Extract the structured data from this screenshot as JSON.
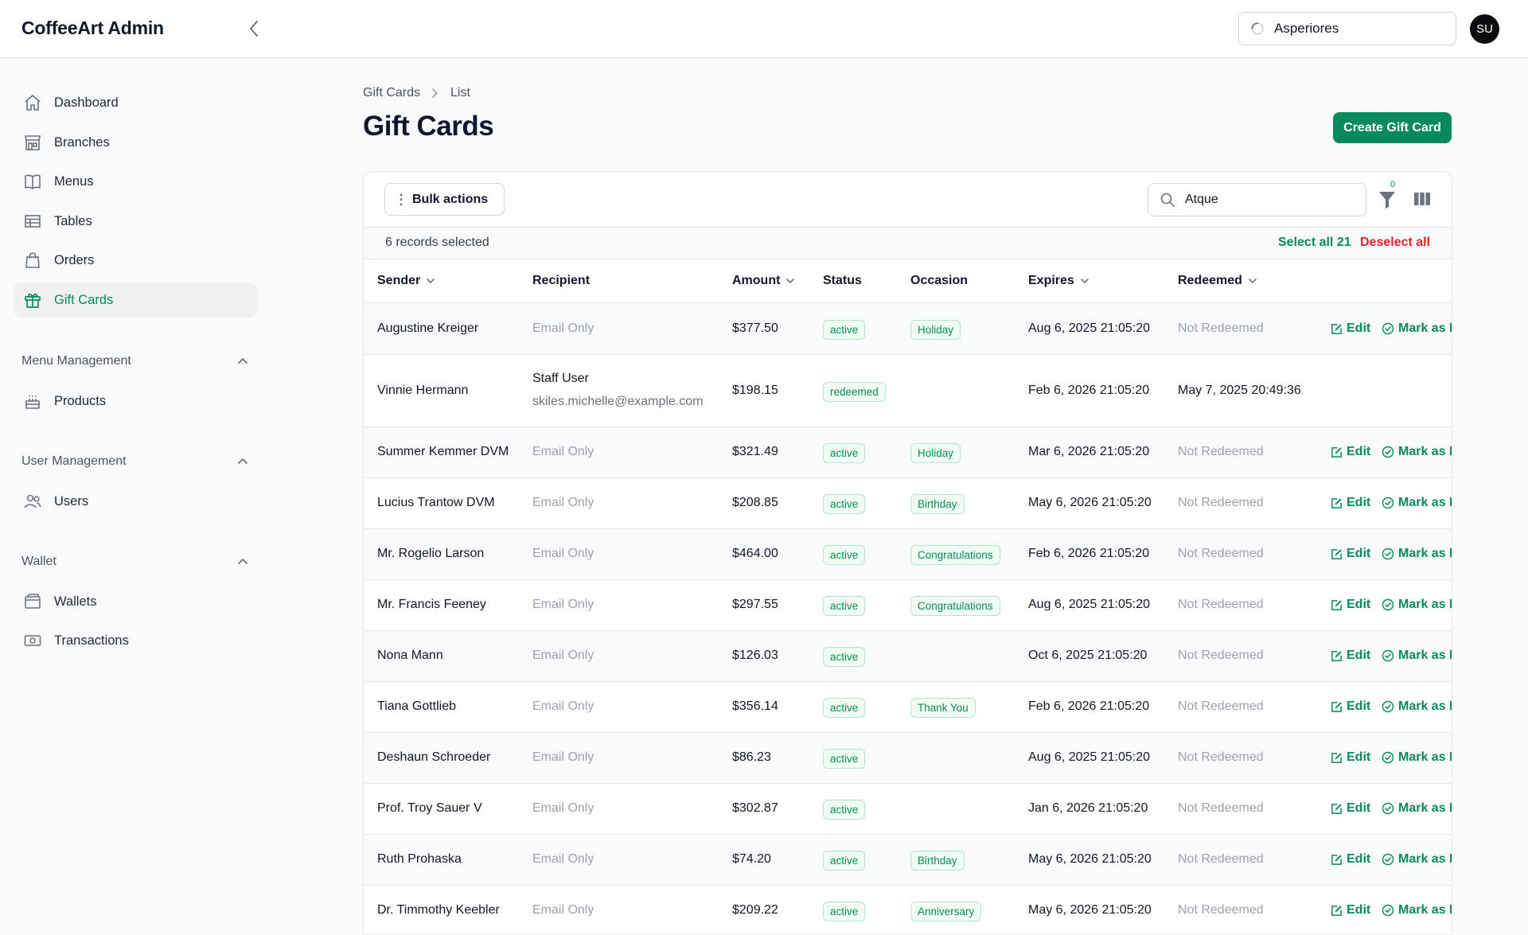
{
  "app": {
    "brand": "CoffeeArt Admin",
    "global_search_value": "Asperiores",
    "avatar_initials": "SU"
  },
  "sidebar": {
    "main_items": [
      {
        "label": "Dashboard",
        "icon": "home-icon"
      },
      {
        "label": "Branches",
        "icon": "store-icon"
      },
      {
        "label": "Menus",
        "icon": "book-icon"
      },
      {
        "label": "Tables",
        "icon": "table-icon"
      },
      {
        "label": "Orders",
        "icon": "bag-icon"
      },
      {
        "label": "Gift Cards",
        "icon": "gift-icon",
        "active": true
      }
    ],
    "groups": [
      {
        "title": "Menu Management",
        "items": [
          {
            "label": "Products",
            "icon": "cake-icon"
          }
        ]
      },
      {
        "title": "User Management",
        "items": [
          {
            "label": "Users",
            "icon": "users-icon"
          }
        ]
      },
      {
        "title": "Wallet",
        "items": [
          {
            "label": "Wallets",
            "icon": "wallet-icon"
          },
          {
            "label": "Transactions",
            "icon": "cash-icon"
          }
        ]
      }
    ]
  },
  "page": {
    "breadcrumb": [
      "Gift Cards",
      "List"
    ],
    "title": "Gift Cards",
    "create_label": "Create Gift Card"
  },
  "table_toolbar": {
    "bulk_label": "Bulk actions",
    "search_value": "Atque",
    "filter_count": "0",
    "selected_text": "6 records selected",
    "select_all_label": "Select all 21",
    "deselect_label": "Deselect all"
  },
  "columns": [
    "Sender",
    "Recipient",
    "Amount",
    "Status",
    "Occasion",
    "Expires",
    "Redeemed"
  ],
  "actions": {
    "edit": "Edit",
    "mark": "Mark as R"
  },
  "rows": [
    {
      "sender": "Augustine Kreiger",
      "recipient": "Email Only",
      "amount": "$377.50",
      "status": "active",
      "occasion": "Holiday",
      "expires": "Aug 6, 2025 21:05:20",
      "redeemed": "Not Redeemed"
    },
    {
      "sender": "Vinnie Hermann",
      "recipient": "Staff User",
      "recipient_email": "skiles.michelle@example.com",
      "amount": "$198.15",
      "status": "redeemed",
      "occasion": "",
      "expires": "Feb 6, 2026 21:05:20",
      "redeemed": "May 7, 2025 20:49:36"
    },
    {
      "sender": "Summer Kemmer DVM",
      "recipient": "Email Only",
      "amount": "$321.49",
      "status": "active",
      "occasion": "Holiday",
      "expires": "Mar 6, 2026 21:05:20",
      "redeemed": "Not Redeemed"
    },
    {
      "sender": "Lucius Trantow DVM",
      "recipient": "Email Only",
      "amount": "$208.85",
      "status": "active",
      "occasion": "Birthday",
      "expires": "May 6, 2026 21:05:20",
      "redeemed": "Not Redeemed"
    },
    {
      "sender": "Mr. Rogelio Larson",
      "recipient": "Email Only",
      "amount": "$464.00",
      "status": "active",
      "occasion": "Congratulations",
      "expires": "Feb 6, 2026 21:05:20",
      "redeemed": "Not Redeemed"
    },
    {
      "sender": "Mr. Francis Feeney",
      "recipient": "Email Only",
      "amount": "$297.55",
      "status": "active",
      "occasion": "Congratulations",
      "expires": "Aug 6, 2025 21:05:20",
      "redeemed": "Not Redeemed"
    },
    {
      "sender": "Nona Mann",
      "recipient": "Email Only",
      "amount": "$126.03",
      "status": "active",
      "occasion": "",
      "expires": "Oct 6, 2025 21:05:20",
      "redeemed": "Not Redeemed"
    },
    {
      "sender": "Tiana Gottlieb",
      "recipient": "Email Only",
      "amount": "$356.14",
      "status": "active",
      "occasion": "Thank You",
      "expires": "Feb 6, 2026 21:05:20",
      "redeemed": "Not Redeemed"
    },
    {
      "sender": "Deshaun Schroeder",
      "recipient": "Email Only",
      "amount": "$86.23",
      "status": "active",
      "occasion": "",
      "expires": "Aug 6, 2025 21:05:20",
      "redeemed": "Not Redeemed"
    },
    {
      "sender": "Prof. Troy Sauer V",
      "recipient": "Email Only",
      "amount": "$302.87",
      "status": "active",
      "occasion": "",
      "expires": "Jan 6, 2026 21:05:20",
      "redeemed": "Not Redeemed"
    },
    {
      "sender": "Ruth Prohaska",
      "recipient": "Email Only",
      "amount": "$74.20",
      "status": "active",
      "occasion": "Birthday",
      "expires": "May 6, 2026 21:05:20",
      "redeemed": "Not Redeemed"
    },
    {
      "sender": "Dr. Timmothy Keebler",
      "recipient": "Email Only",
      "amount": "$209.22",
      "status": "active",
      "occasion": "Anniversary",
      "expires": "May 6, 2026 21:05:20",
      "redeemed": "Not Redeemed"
    }
  ],
  "colors": {
    "accent": "#0a8a5c",
    "danger": "#dc2626",
    "muted": "#9ca3af"
  }
}
